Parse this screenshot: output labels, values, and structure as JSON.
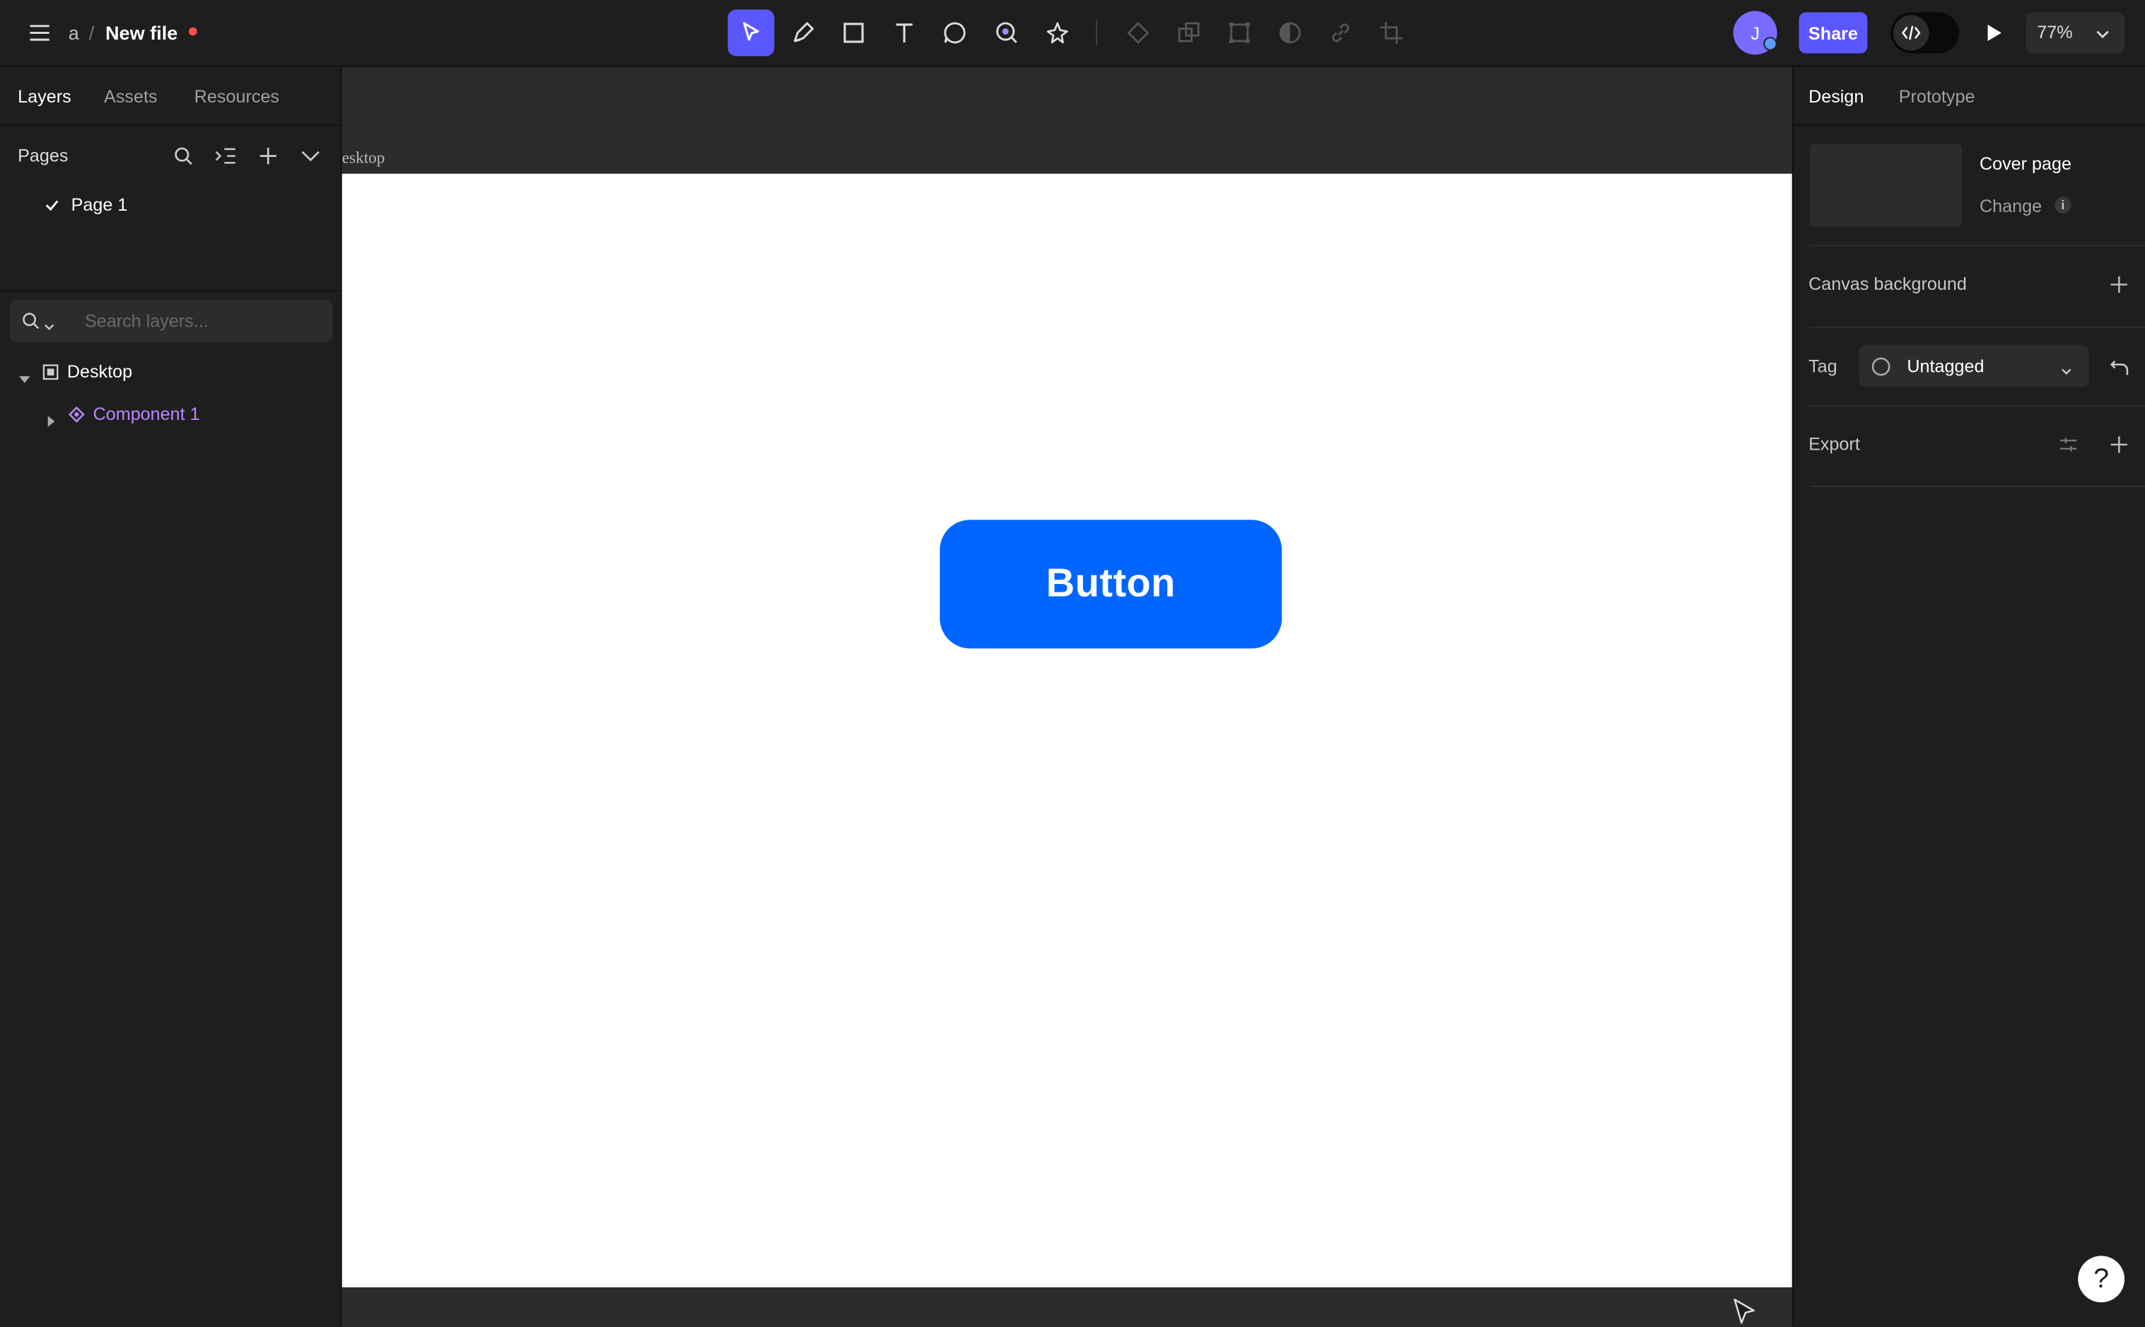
{
  "topbar": {
    "project": "a",
    "separator": "/",
    "file_name": "New file",
    "share_label": "Share",
    "avatar_initial": "J",
    "zoom": "77%"
  },
  "left_panel": {
    "tabs": [
      "Layers",
      "Assets",
      "Resources"
    ],
    "pages_title": "Pages",
    "pages": [
      {
        "label": "Page 1",
        "checked": true
      }
    ],
    "search_placeholder": "Search layers...",
    "layers": [
      {
        "label": "Desktop",
        "type": "frame",
        "expanded": true
      },
      {
        "label": "Component 1",
        "type": "component",
        "expanded": false
      }
    ]
  },
  "canvas": {
    "frame_label": "esktop",
    "button_text": "Button",
    "button_color": "#0066ff"
  },
  "right_panel": {
    "tabs": [
      "Design",
      "Prototype"
    ],
    "cover_title": "Cover page",
    "cover_change": "Change",
    "canvas_background": "Canvas background",
    "tag_label": "Tag",
    "tag_value": "Untagged",
    "export_label": "Export"
  },
  "colors": {
    "accent": "#5b57ff",
    "component": "#b888ff",
    "unsaved_dot": "#ff4d4d"
  },
  "help": "?"
}
